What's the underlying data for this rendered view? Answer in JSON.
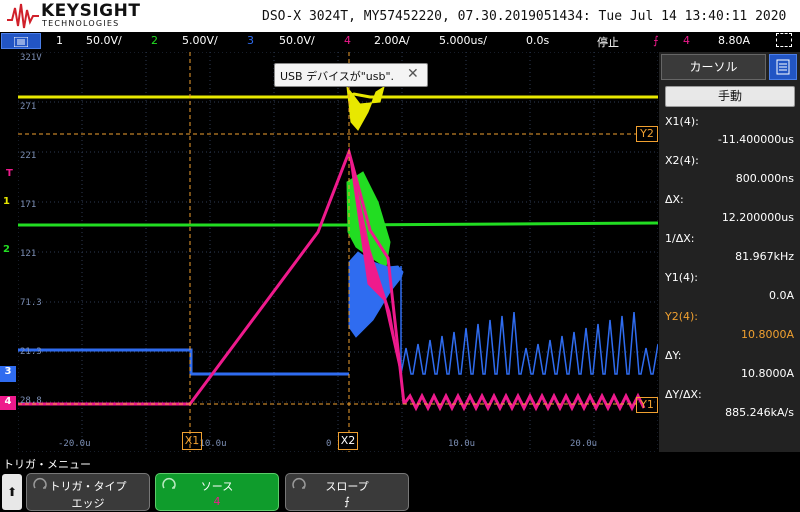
{
  "header": {
    "brand": "KEYSIGHT",
    "brand_sub": "TECHNOLOGIES",
    "title": "DSO-X 3024T, MY57452220, 07.30.2019051434: Tue Jul 14 13:40:11 2020"
  },
  "channel_bar": {
    "ch1": {
      "num": "1",
      "scale": "50.0V/"
    },
    "ch2": {
      "num": "2",
      "scale": "5.00V/"
    },
    "ch3": {
      "num": "3",
      "scale": "50.0V/"
    },
    "ch4": {
      "num": "4",
      "scale": "2.00A/"
    },
    "timebase": "5.000us/",
    "delay": "0.0s",
    "run_state": "停止",
    "trigger_source": "4",
    "trigger_level": "8.80A"
  },
  "notification": {
    "text": "USB デバイスが\"usb\"."
  },
  "grid_labels": [
    "321V",
    "271",
    "221",
    "171",
    "121",
    "71.3",
    "21.3",
    "28.8"
  ],
  "time_labels": [
    "-20.0u",
    "-10.0u",
    "0",
    "10.0u",
    "20.0u"
  ],
  "markers": {
    "x1": "X1",
    "x2": "X2",
    "y1": "Y1",
    "y2": "Y2",
    "trigger": "T",
    "ch1": "1",
    "ch2": "2",
    "ch3": "3",
    "ch4": "4"
  },
  "cursor_panel": {
    "tab_label": "カーソル",
    "mode_label": "手動",
    "rows": [
      {
        "key": "X1(4):",
        "value": "-11.400000us"
      },
      {
        "key": "X2(4):",
        "value": "800.000ns"
      },
      {
        "key": "ΔX:",
        "value": "12.200000us"
      },
      {
        "key": "1/ΔX:",
        "value": "81.967kHz"
      },
      {
        "key": "Y1(4):",
        "value": "0.0A"
      },
      {
        "key": "Y2(4):",
        "value": "10.8000A"
      },
      {
        "key": "ΔY:",
        "value": "10.8000A"
      },
      {
        "key": "ΔY/ΔX:",
        "value": "885.246kA/s"
      }
    ]
  },
  "softkeys": {
    "menu_title": "トリガ・メニュー",
    "back_label": "⬆",
    "trigger_type": {
      "label": "トリガ・タイプ",
      "value": "エッジ"
    },
    "source": {
      "label": "ソース",
      "value": "4"
    },
    "slope": {
      "label": "スロープ",
      "value": "⨍"
    }
  },
  "colors": {
    "ch1": "#e8e800",
    "ch2": "#22dd22",
    "ch3": "#2f6cf0",
    "ch4": "#ee1a8c",
    "cursor": "#f0a030",
    "y2_value": "#f0a030"
  }
}
